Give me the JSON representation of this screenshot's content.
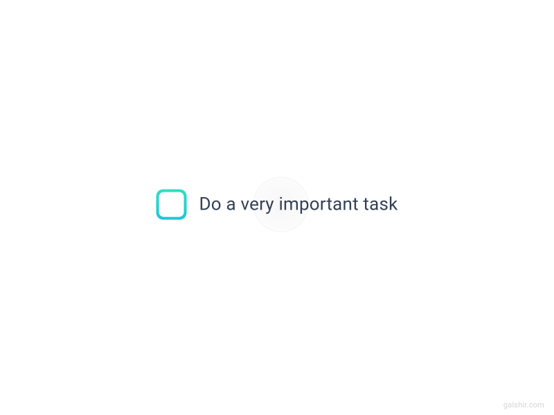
{
  "task": {
    "label": "Do a very important task",
    "completed": false
  },
  "attribution": {
    "text": "galshir.com"
  }
}
